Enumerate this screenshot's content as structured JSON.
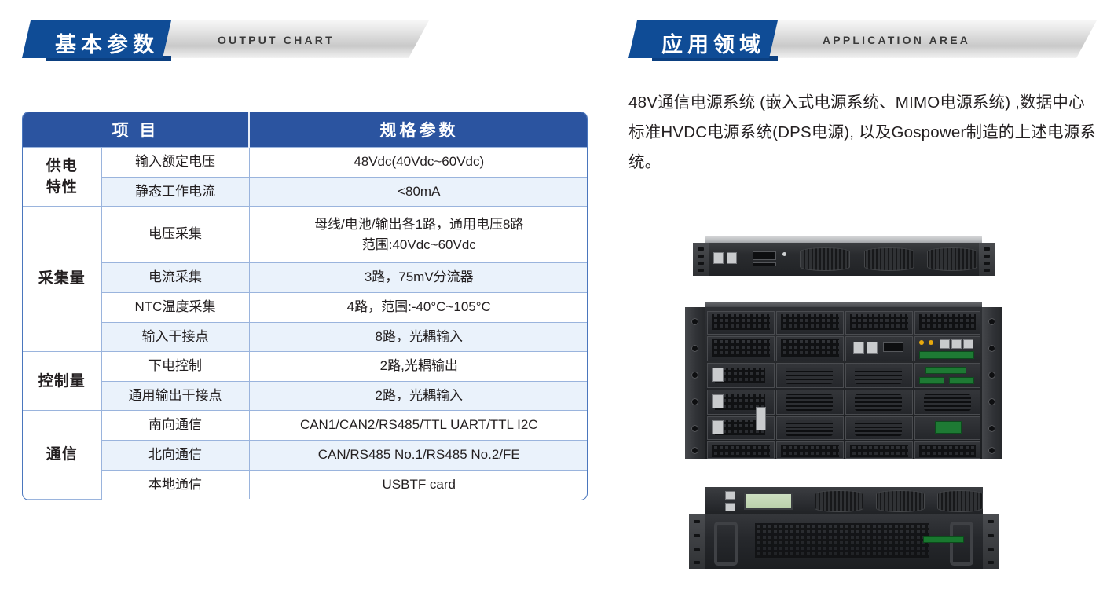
{
  "sections": {
    "left": {
      "title_cn": "基本参数",
      "title_en": "OUTPUT CHART"
    },
    "right": {
      "title_cn": "应用领域",
      "title_en": "APPLICATION AREA"
    }
  },
  "spec_table": {
    "headers": [
      "项 目",
      "规格参数"
    ],
    "groups": [
      {
        "name": "供电\n特性",
        "rows": [
          {
            "item": "输入额定电压",
            "value": "48Vdc(40Vdc~60Vdc)",
            "alt": false
          },
          {
            "item": "静态工作电流",
            "value": "<80mA",
            "alt": true
          }
        ]
      },
      {
        "name": "采集量",
        "rows": [
          {
            "item": "电压采集",
            "value": "母线/电池/输出各1路，通用电压8路\n范围:40Vdc~60Vdc",
            "alt": false
          },
          {
            "item": "电流采集",
            "value": "3路，75mV分流器",
            "alt": true
          },
          {
            "item": "NTC温度采集",
            "value": "4路，范围:-40°C~105°C",
            "alt": false
          },
          {
            "item": "输入干接点",
            "value": "8路，光耦输入",
            "alt": true
          }
        ]
      },
      {
        "name": "控制量",
        "rows": [
          {
            "item": "下电控制",
            "value": "2路,光耦输出",
            "alt": false
          },
          {
            "item": "通用输出干接点",
            "value": "2路，光耦输入",
            "alt": true
          }
        ]
      },
      {
        "name": "通信",
        "rows": [
          {
            "item": "南向通信",
            "value": "CAN1/CAN2/RS485/TTL UART/TTL I2C",
            "alt": false
          },
          {
            "item": "北向通信",
            "value": "CAN/RS485 No.1/RS485 No.2/FE",
            "alt": true
          },
          {
            "item": "本地通信",
            "value": "USBTF card",
            "alt": false
          }
        ]
      }
    ]
  },
  "application": {
    "paragraph": "48V通信电源系统 (嵌入式电源系统、MIMO电源系统) ,数据中心标准HVDC电源系统(DPS电源), 以及Gospower制造的上述电源系统。"
  },
  "devices": [
    {
      "name": "1u-rack-power-shelf"
    },
    {
      "name": "multi-bay-power-rack"
    },
    {
      "name": "2u-rack-power-system"
    }
  ],
  "colors": {
    "brand_blue": "#0f4c96",
    "table_header_blue": "#2b54a0",
    "row_alt_blue": "#eaf2fb",
    "table_border_blue": "#9ab4dd",
    "text_dark": "#231f20"
  }
}
